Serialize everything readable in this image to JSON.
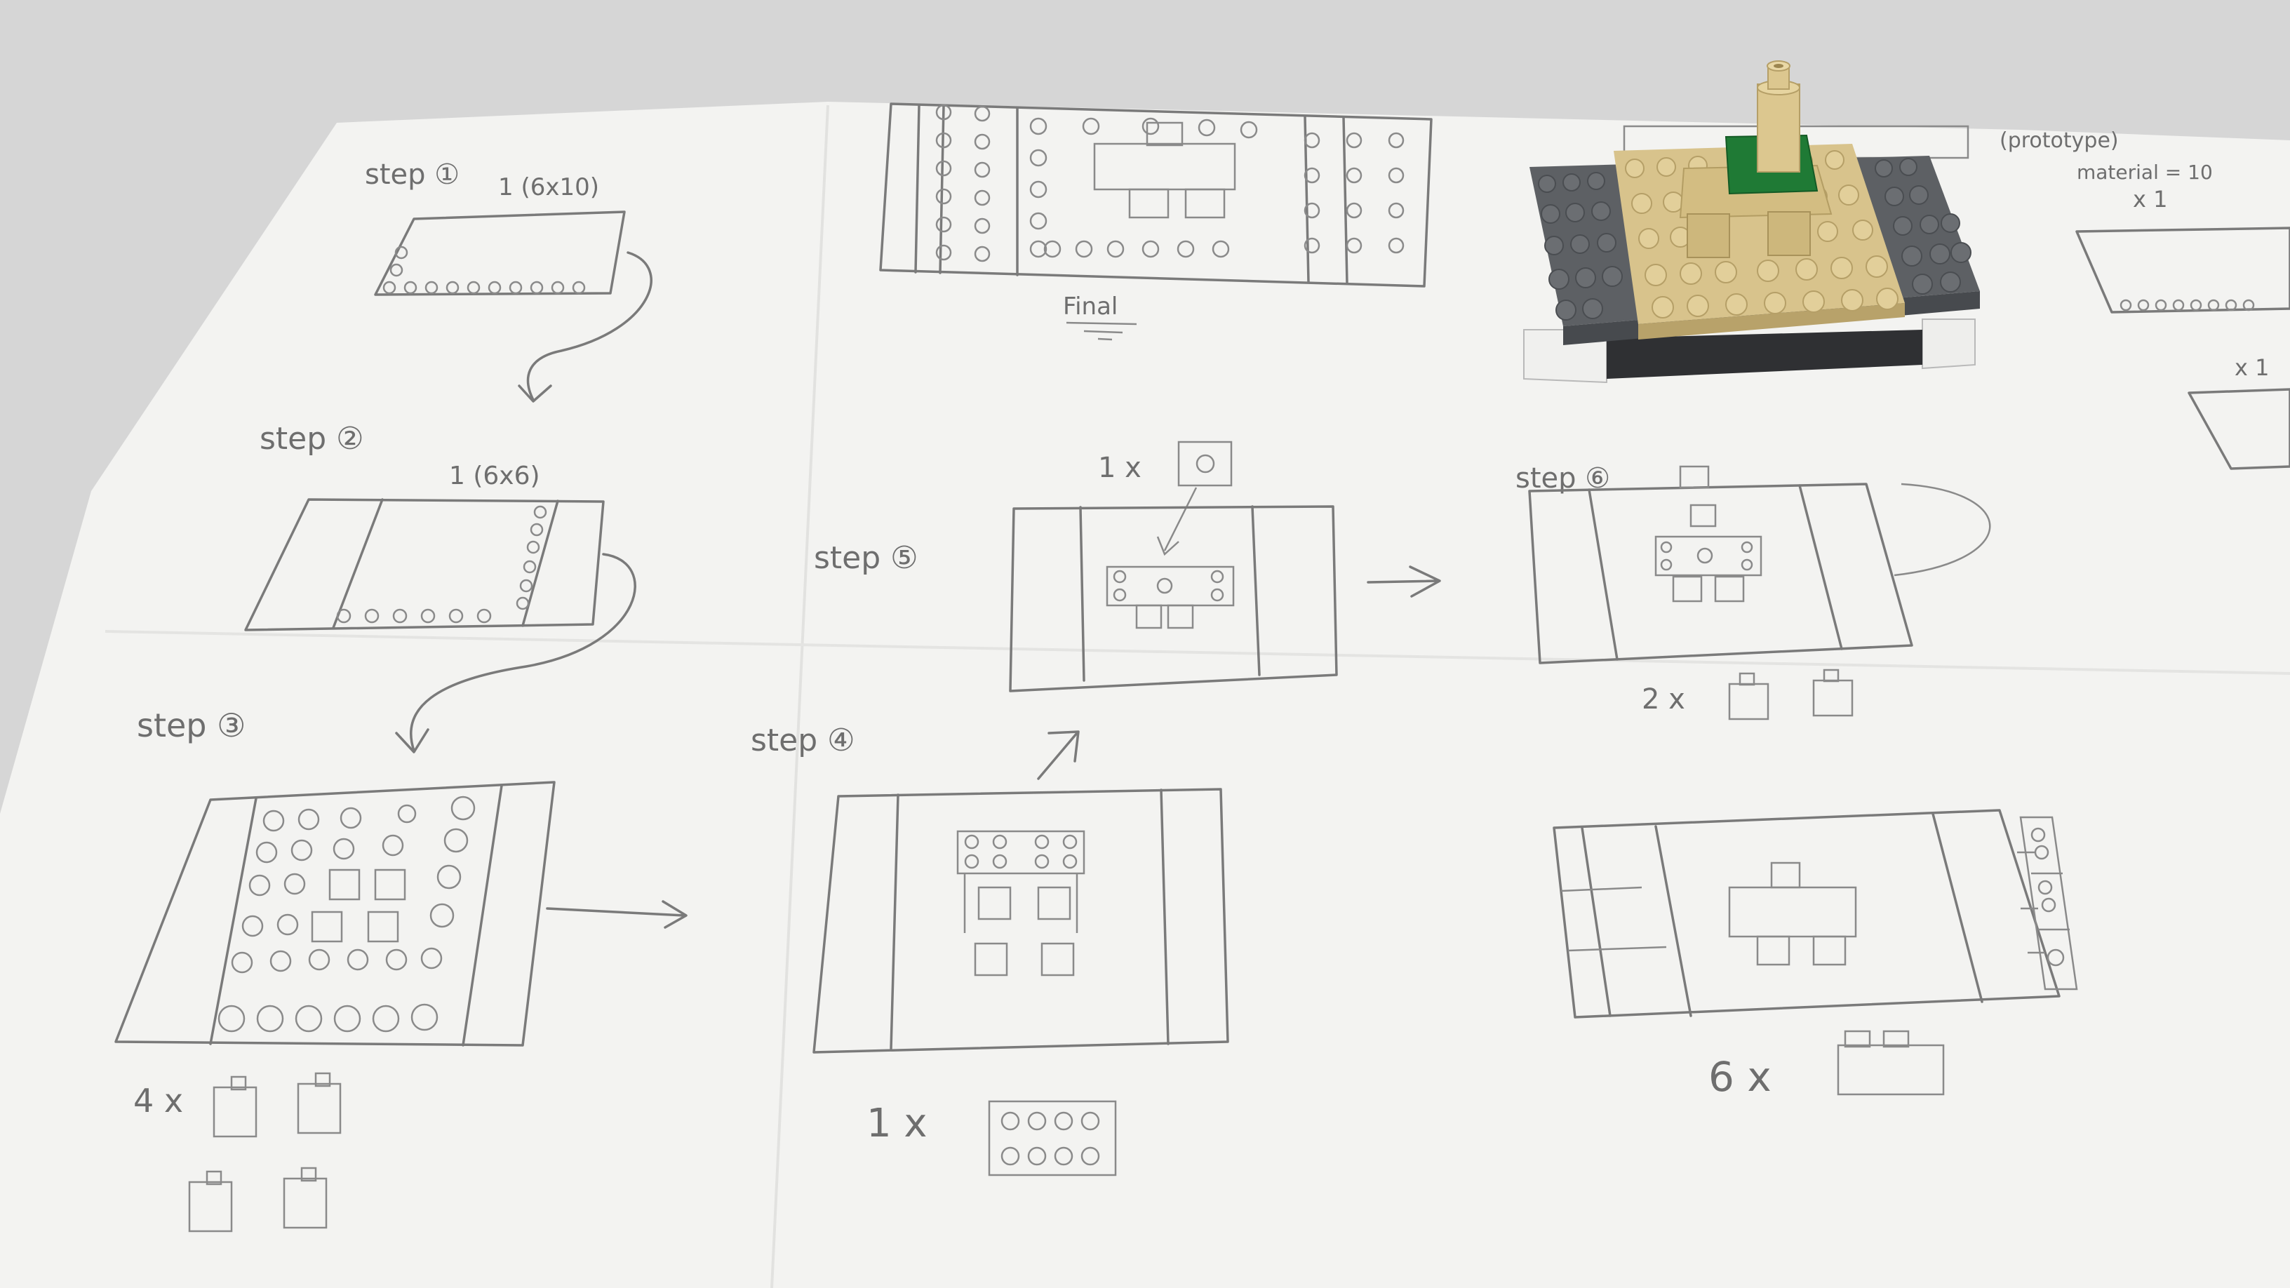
{
  "sheet": {
    "step1": {
      "label": "step ①",
      "note": "1 (6x10)"
    },
    "step2": {
      "label": "step ②",
      "note": "1 (6x6)"
    },
    "step3": {
      "label": "step ③",
      "note": "4 x"
    },
    "step4": {
      "label": "step ④",
      "note": "1 x"
    },
    "step5": {
      "label": "step ⑤",
      "note": "1 x"
    },
    "step6": {
      "label": "step ⑥",
      "note": "2 x"
    },
    "step7": {
      "note": "6 x"
    },
    "final": {
      "label": "Final"
    },
    "right_side": {
      "title_fragment": "(prototype)",
      "material": "material = 10",
      "count_a": "x 1",
      "count_b": "x 1"
    }
  },
  "colors": {
    "background": "#d9d9d9",
    "paper": "#f4f4f2",
    "pencil": "#7a7a7a",
    "lego_gray": "#5f6266",
    "lego_tan": "#d9c48c",
    "lego_green": "#1f7a35",
    "lego_white": "#f2f2f2"
  }
}
